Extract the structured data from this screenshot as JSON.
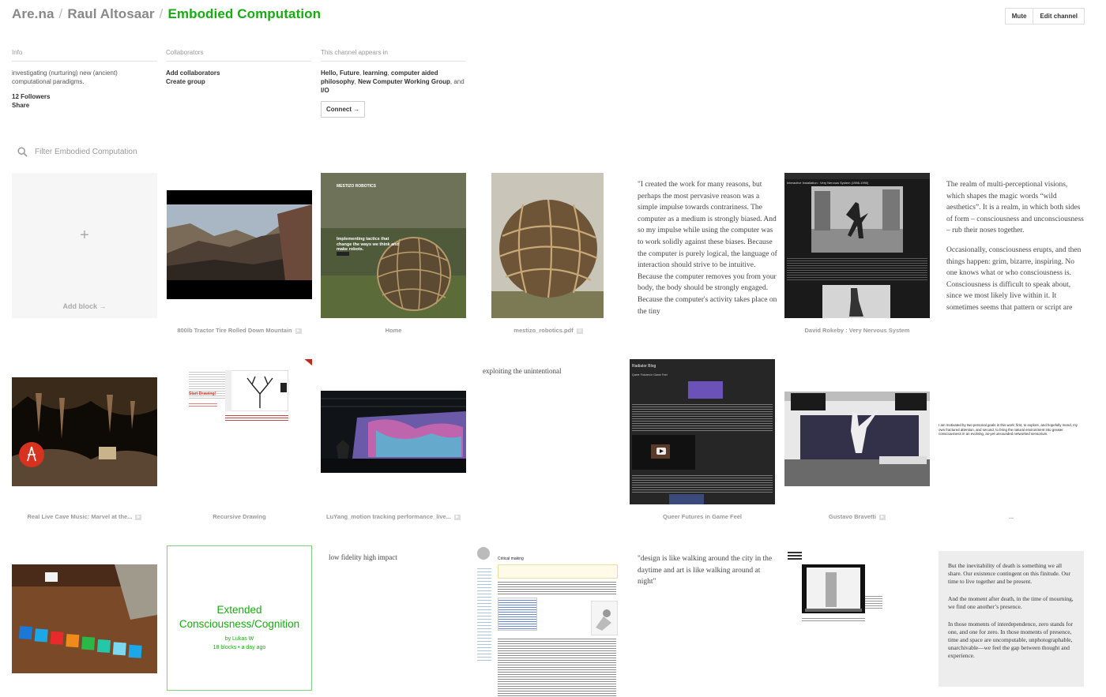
{
  "breadcrumb": {
    "root": "Are.na",
    "user": "Raul Altosaar",
    "channel": "Embodied Computation"
  },
  "actions": {
    "mute": "Mute",
    "edit": "Edit channel"
  },
  "info": {
    "heading": "Info",
    "description": "investigating (nurturing) new (ancient) computational paradigms.",
    "followers": "12 Followers",
    "share": "Share"
  },
  "collaborators": {
    "heading": "Collaborators",
    "add": "Add collaborators",
    "create_group": "Create group"
  },
  "appears_in": {
    "heading": "This channel appears in",
    "ch1": "Hello, Future",
    "sep1": ", ",
    "ch2": "learning",
    "sep2": ", ",
    "ch3": "computer aided philosophy",
    "sep3": ", ",
    "ch4": "New Computer Working Group",
    "sep4": ", and ",
    "ch5": "I/O",
    "connect": "Connect →"
  },
  "filter": {
    "placeholder": "Filter Embodied Computation"
  },
  "blocks": {
    "add": {
      "plus": "+",
      "label": "Add block →"
    },
    "c1": "800lb Tractor Tire Rolled Down Mountain",
    "c2": "Home",
    "c3": "mestizo_robotics.pdf",
    "c5": "David Rokeby : Very Nervous System",
    "c8": "Real Live Cave Music: Marvel at the...",
    "c9": "Recursive Drawing",
    "c10": "LuYang_motion tracking performance_live...",
    "c12": "Queer Futures in Game Feel",
    "c13": "Gustavo Bravetti",
    "c14": "...",
    "quote1": "\"I created the work for many reasons, but perhaps the most pervasive reason was a simple impulse towards contrariness. The computer as a medium is strongly biased. And so my impulse while using the computer was to work solidly against these biases. Because the computer is purely logical, the language of interaction should strive to be intuitive. Because the computer removes you from your body, the body should be strongly engaged. Because the computer's activity takes place on the tiny",
    "realm_p1": "The realm of multi-perceptional visions, which shapes the magic words “wild aesthetics”. It is a realm, in which both sides of form – consciousness and unconsciousness – rub their noses together.",
    "realm_p2": "Occasionally, consciousness erupts, and then things happen: grim, bizarre, inspiring. No one knows what or who consciousness is. Consciousness is difficult to speak about, since we most likely live within it. It sometimes seems that pattern or script are",
    "exploit": "exploiting the unintentional",
    "motivated": "I am motivated by two personal goals in this work: first, to explore, and hopefully mend, my own fractured attention, and second, to bring the natural environment into greater consciousness in an evolving, as-yet unsounded networked sensorium.",
    "lowfi": "low fidelity high impact",
    "walking": "\"design is like walking around the city in the daytime and art is like walking around at night\"",
    "death_p1": "But the inevitability of death is something we all share. Our existence contingent on this finitude. Our time to live together and be present.",
    "death_p2": "And the moment after death, in the time of mourning, we find one another’s presence.",
    "death_p3": "In those moments of interdependence, zero stands for one, and one for zero. In those moments of presence, time and space are uncomputable, unphotographable, unarchivable—we feel the gap between thought and experience."
  },
  "channel_card": {
    "title": "Extended Consciousness/Cognition",
    "by": "by Lukas W",
    "meta": "18 blocks • a day ago"
  },
  "screens": {
    "mestizo_title": "MESTIZO ROBOTICS",
    "mestizo_tagline": "Implementing tactics that change the ways we think and make robots.",
    "recursive_heading": "Start Drawing!",
    "radiator_title": "Radiator Blog",
    "radiator_post": "Queer Futures in Game Feel",
    "vns_title": "Interactive Installation : Very Nervous System (1986-1990)",
    "wiki_title": "Critical making"
  },
  "colors": {
    "accent": "#17ac10",
    "channel_border": "#7ad37a"
  }
}
